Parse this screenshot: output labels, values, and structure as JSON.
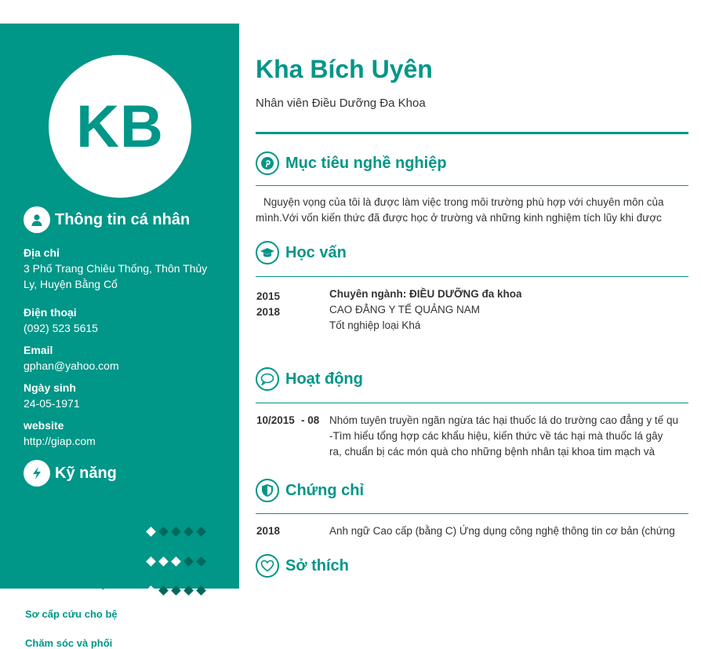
{
  "sidebar": {
    "initials": "KB",
    "personal_heading": "Thông tin cá nhân",
    "address_label": "Địa chỉ",
    "address_value": "3 Phố Trang Chiêu Thống, Thôn Thủy Ly, Huyện Bằng Cổ",
    "phone_label": "Điện thoại",
    "phone_value": "(092) 523 5615",
    "email_label": "Email",
    "email_value": "gphan@yahoo.com",
    "dob_label": "Ngày sinh",
    "dob_value": "24-05-1971",
    "website_label": "website",
    "website_value": "http://giap.com",
    "skills_heading": "Kỹ năng",
    "skills": [
      {
        "name": "Khám và điều trị c",
        "level": 1
      },
      {
        "name": "Sơ cấp cứu cho bệ",
        "level": 3
      },
      {
        "name": "Chăm sóc và phối",
        "level": 1
      }
    ]
  },
  "main": {
    "name": "Kha Bích Uyên",
    "role": "Nhân viên Điều Dưỡng Đa Khoa",
    "objective_heading": "Mục tiêu nghề nghiệp",
    "objective_line1": "Nguyện vọng của tôi là được làm việc trong môi trường phù hợp với chuyên môn của",
    "objective_line2": "mình.Với vốn kiến thức đã được học ở trường và những kinh nghiệm tích lũy khi được",
    "education_heading": "Học vấn",
    "edu_start": "2015",
    "edu_end": "2018",
    "edu_major": "Chuyên ngành: ĐIỀU DƯỠNG đa khoa",
    "edu_school": "CAO ĐẲNG Y TẾ QUẢNG NAM",
    "edu_result": "Tốt nghiệp loại Khá",
    "activity_heading": "Hoạt động",
    "act_date": "10/2015",
    "act_date_end": "- 08",
    "act_line1": "Nhóm tuyên truyền ngăn ngừa tác hại thuốc lá do trường cao đẳng y tế qu",
    "act_line2": "-Tìm hiểu tổng hợp các khẩu hiệu, kiến thức về tác hại mà thuốc lá gây",
    "act_line3": "ra, chuẩn bị các món quà cho những bệnh nhân tại khoa tim mạch và",
    "cert_heading": "Chứng chỉ",
    "cert_year": "2018",
    "cert_text": "Anh ngữ Cao cấp (bằng C) Ứng dụng công nghệ thông tin cơ bản (chứng",
    "hobby_heading": "Sở thích"
  },
  "colors": {
    "accent": "#009688",
    "accent_dark": "#00695c"
  },
  "icons": [
    "user-icon",
    "lightning-icon",
    "pinterest-icon",
    "graduation-cap-icon",
    "chat-bubble-icon",
    "shield-icon",
    "heart-icon"
  ]
}
